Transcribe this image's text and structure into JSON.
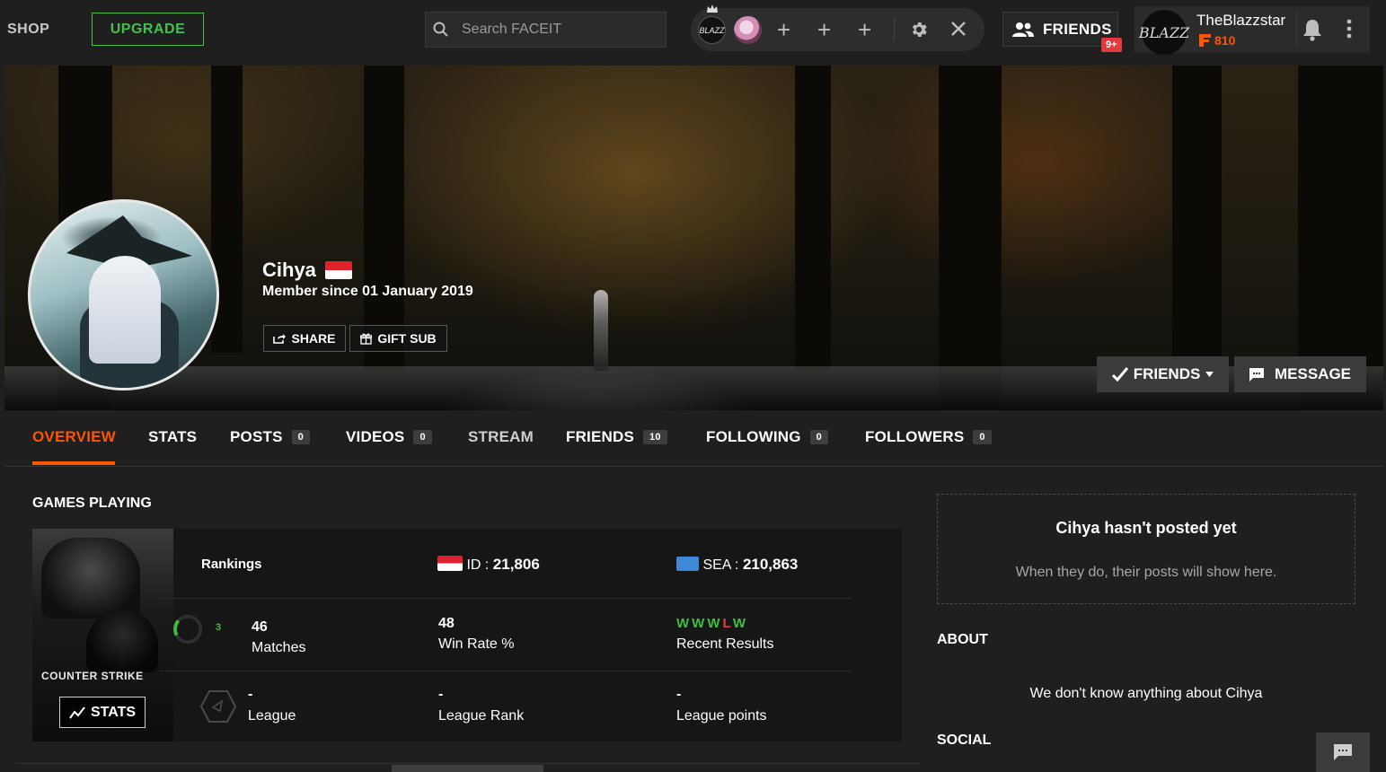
{
  "topbar": {
    "shop_label": "SHOP",
    "upgrade_label": "UPGRADE",
    "search_placeholder": "Search FACEIT",
    "party_avatar_text": "BLAZZ",
    "friends_label": "FRIENDS",
    "friends_badge": "9+",
    "user": {
      "name": "TheBlazzstar",
      "avatar_text": "BLAZZ",
      "points": "810"
    }
  },
  "profile": {
    "name": "Cihya",
    "member_since": "Member since 01 January 2019",
    "share_label": "SHARE",
    "gift_label": "GIFT SUB",
    "friends_btn_label": "FRIENDS",
    "message_btn_label": "MESSAGE"
  },
  "tabs": [
    {
      "label": "OVERVIEW",
      "count": null,
      "active": true
    },
    {
      "label": "STATS",
      "count": null
    },
    {
      "label": "POSTS",
      "count": "0"
    },
    {
      "label": "VIDEOS",
      "count": "0"
    },
    {
      "label": "STREAM",
      "count": null
    },
    {
      "label": "FRIENDS",
      "count": "10"
    },
    {
      "label": "FOLLOWING",
      "count": "0"
    },
    {
      "label": "FOLLOWERS",
      "count": "0"
    }
  ],
  "games": {
    "title": "GAMES PLAYING",
    "cover_logo": "COUNTER STRIKE",
    "stats_label": "STATS",
    "rankings_label": "Rankings",
    "id_label": "ID :",
    "id_value": "21,806",
    "sea_label": "SEA :",
    "sea_value": "210,863",
    "level": "3",
    "matches_value": "46",
    "matches_label": "Matches",
    "winrate_value": "48",
    "winrate_label": "Win Rate %",
    "recent_results": [
      "W",
      "W",
      "W",
      "L",
      "W"
    ],
    "recent_label": "Recent Results",
    "league_value": "-",
    "league_label": "League",
    "league_rank_value": "-",
    "league_rank_label": "League Rank",
    "league_points_value": "-",
    "league_points_label": "League points"
  },
  "sidebar": {
    "empty_title": "Cihya hasn't posted yet",
    "empty_sub": "When they do, their posts will show here.",
    "about_heading": "ABOUT",
    "about_text": "We don't know anything about Cihya",
    "social_heading": "SOCIAL"
  },
  "colors": {
    "accent": "#ff5500",
    "upgrade": "#43c24a",
    "win": "#3dbf3d",
    "loss": "#e23d3d",
    "badge": "#e33b3b"
  }
}
